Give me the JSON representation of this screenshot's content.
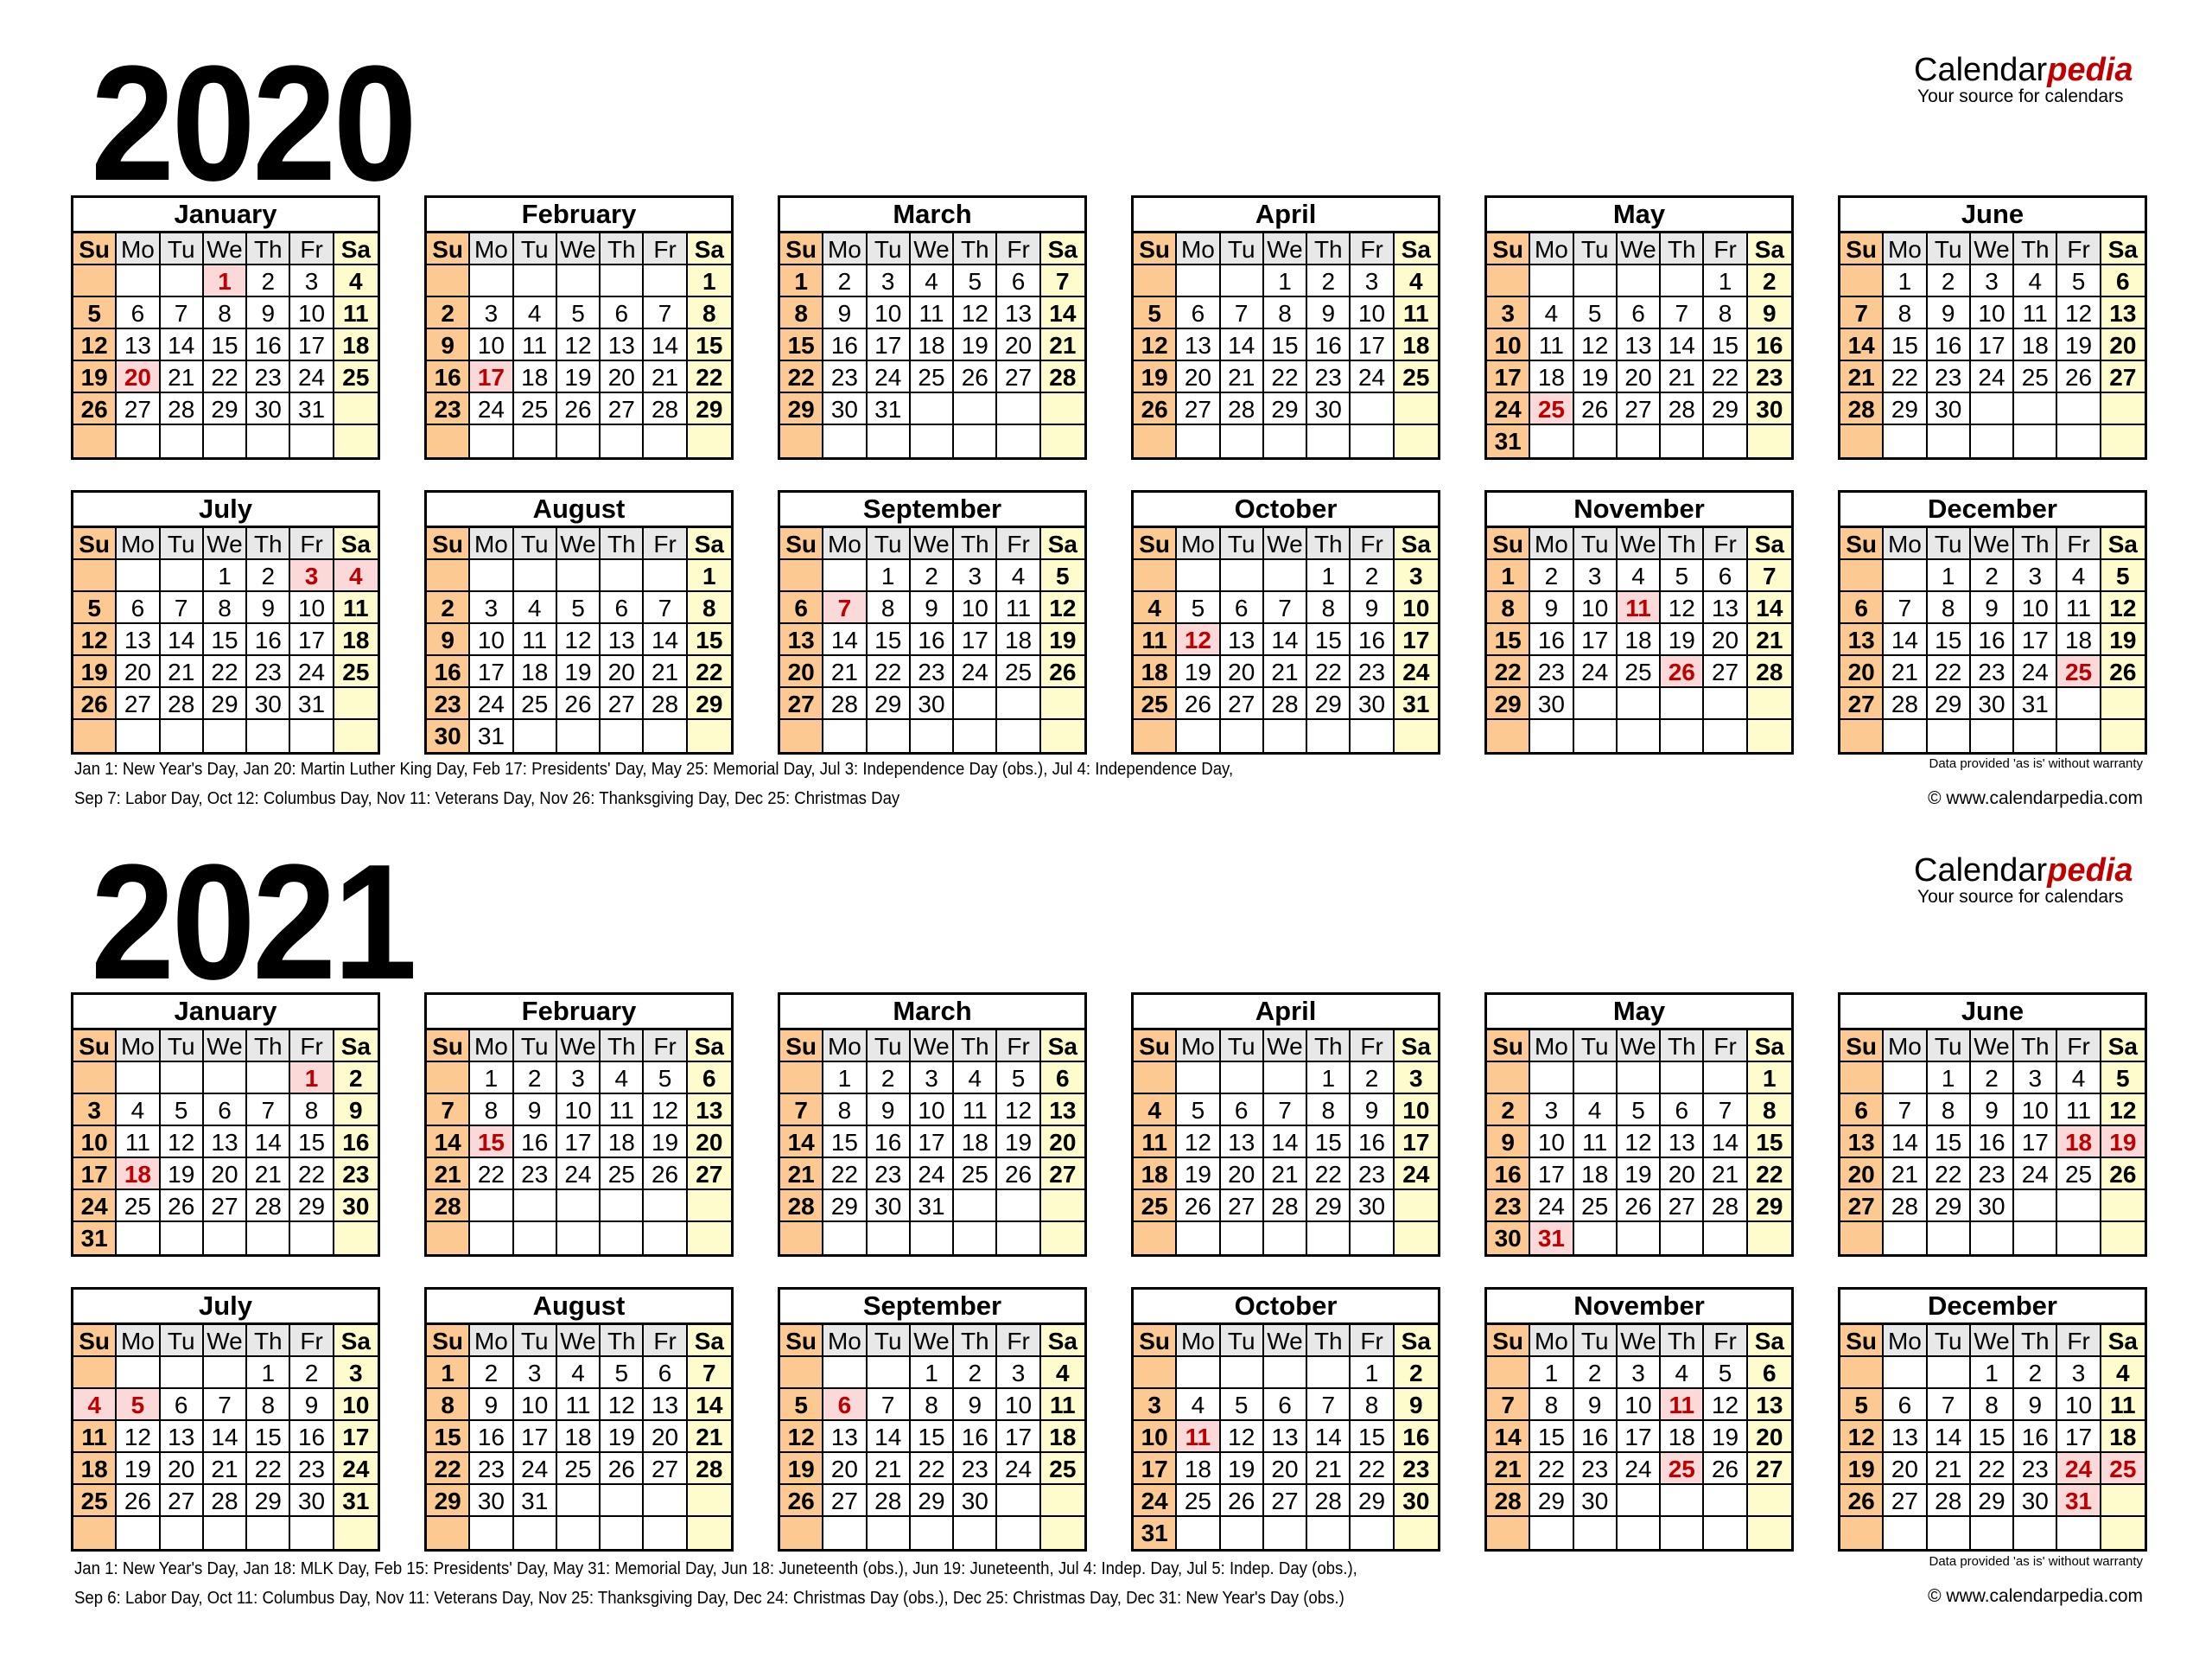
{
  "logo": {
    "name_main": "Calendar",
    "name_accent": "pedia",
    "tagline": "Your source for calendars"
  },
  "weekday_labels": [
    "Su",
    "Mo",
    "Tu",
    "We",
    "Th",
    "Fr",
    "Sa"
  ],
  "disclaimer": "Data provided 'as is' without warranty",
  "copyright": "© www.calendarpedia.com",
  "colors": {
    "sunday": "#fcc992",
    "saturday": "#fefccd",
    "weekday_header": "#e8e8e8",
    "holiday_bg": "#fcd9d9",
    "holiday_text": "#c00000"
  },
  "years": [
    {
      "year": "2020",
      "notes": [
        "Jan 1: New Year's Day, Jan 20: Martin Luther King Day, Feb 17: Presidents' Day, May 25: Memorial Day, Jul 3: Independence Day (obs.), Jul 4: Independence Day,",
        "Sep 7: Labor Day, Oct 12: Columbus Day, Nov 11: Veterans Day, Nov 26: Thanksgiving Day, Dec 25: Christmas Day"
      ],
      "months": [
        {
          "name": "January",
          "start": 3,
          "days": 31,
          "holidays": [
            1,
            20
          ]
        },
        {
          "name": "February",
          "start": 6,
          "days": 29,
          "holidays": [
            17
          ]
        },
        {
          "name": "March",
          "start": 0,
          "days": 31,
          "holidays": []
        },
        {
          "name": "April",
          "start": 3,
          "days": 30,
          "holidays": []
        },
        {
          "name": "May",
          "start": 5,
          "days": 31,
          "holidays": [
            25
          ]
        },
        {
          "name": "June",
          "start": 1,
          "days": 30,
          "holidays": []
        },
        {
          "name": "July",
          "start": 3,
          "days": 31,
          "holidays": [
            3,
            4
          ]
        },
        {
          "name": "August",
          "start": 6,
          "days": 31,
          "holidays": []
        },
        {
          "name": "September",
          "start": 2,
          "days": 30,
          "holidays": [
            7
          ]
        },
        {
          "name": "October",
          "start": 4,
          "days": 31,
          "holidays": [
            12
          ]
        },
        {
          "name": "November",
          "start": 0,
          "days": 30,
          "holidays": [
            11,
            26
          ]
        },
        {
          "name": "December",
          "start": 2,
          "days": 31,
          "holidays": [
            25
          ]
        }
      ]
    },
    {
      "year": "2021",
      "notes": [
        "Jan 1: New Year's Day, Jan 18: MLK Day, Feb 15: Presidents' Day, May 31: Memorial Day, Jun 18: Juneteenth (obs.), Jun 19: Juneteenth, Jul 4: Indep. Day, Jul 5: Indep. Day (obs.),",
        "Sep 6: Labor Day, Oct 11: Columbus Day, Nov 11: Veterans Day, Nov 25: Thanksgiving Day, Dec 24: Christmas Day (obs.), Dec 25: Christmas Day, Dec 31: New Year's Day (obs.)"
      ],
      "months": [
        {
          "name": "January",
          "start": 5,
          "days": 31,
          "holidays": [
            1,
            18
          ]
        },
        {
          "name": "February",
          "start": 1,
          "days": 28,
          "holidays": [
            15
          ]
        },
        {
          "name": "March",
          "start": 1,
          "days": 31,
          "holidays": []
        },
        {
          "name": "April",
          "start": 4,
          "days": 30,
          "holidays": []
        },
        {
          "name": "May",
          "start": 6,
          "days": 31,
          "holidays": [
            31
          ]
        },
        {
          "name": "June",
          "start": 2,
          "days": 30,
          "holidays": [
            18,
            19
          ]
        },
        {
          "name": "July",
          "start": 4,
          "days": 31,
          "holidays": [
            4,
            5
          ]
        },
        {
          "name": "August",
          "start": 0,
          "days": 31,
          "holidays": []
        },
        {
          "name": "September",
          "start": 3,
          "days": 30,
          "holidays": [
            6
          ]
        },
        {
          "name": "October",
          "start": 5,
          "days": 31,
          "holidays": [
            11
          ]
        },
        {
          "name": "November",
          "start": 1,
          "days": 30,
          "holidays": [
            11,
            25
          ]
        },
        {
          "name": "December",
          "start": 3,
          "days": 31,
          "holidays": [
            24,
            25,
            31
          ]
        }
      ]
    }
  ]
}
